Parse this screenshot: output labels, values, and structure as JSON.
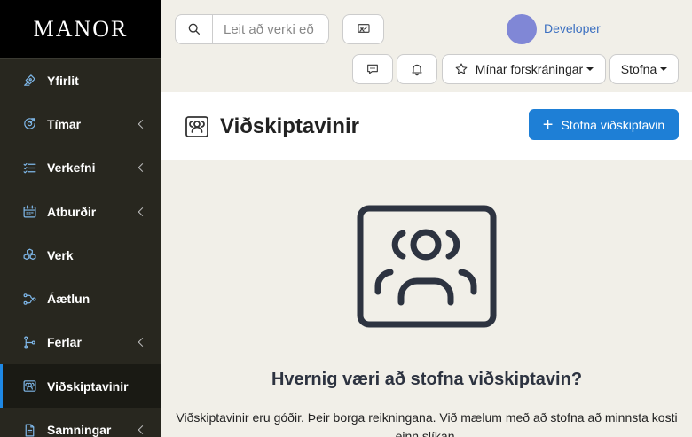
{
  "brand": "MANOR",
  "sidebar": {
    "items": [
      {
        "label": "Yfirlit",
        "icon": "pen-tool-icon",
        "chevron": false
      },
      {
        "label": "Tímar",
        "icon": "clock-arrow-icon",
        "chevron": true
      },
      {
        "label": "Verkefni",
        "icon": "checklist-icon",
        "chevron": true
      },
      {
        "label": "Atburðir",
        "icon": "calendar-icon",
        "chevron": true
      },
      {
        "label": "Verk",
        "icon": "cubes-icon",
        "chevron": false
      },
      {
        "label": "Áætlun",
        "icon": "flow-icon",
        "chevron": false
      },
      {
        "label": "Ferlar",
        "icon": "branch-icon",
        "chevron": true
      },
      {
        "label": "Viðskiptavinir",
        "icon": "users-frame-icon",
        "chevron": false,
        "active": true
      },
      {
        "label": "Samningar",
        "icon": "document-icon",
        "chevron": true
      }
    ]
  },
  "topbar": {
    "search_placeholder": "Leit að verki eð",
    "favorites_label": "Mínar forskráningar",
    "create_label": "Stofna",
    "user_name": "Developer"
  },
  "header": {
    "title": "Viðskiptavinir",
    "create_button": "Stofna viðskiptavin"
  },
  "empty_state": {
    "heading": "Hvernig væri að stofna viðskiptavin?",
    "text": "Viðskiptavinir eru góðir. Þeir borga reikningana. Við mælum með að stofna að minnsta kosti einn slíkan."
  },
  "colors": {
    "accent": "#1e7fd6",
    "sidebar_bg": "#28271f",
    "icon_blue": "#7fb8ea",
    "avatar": "#8087d6"
  }
}
